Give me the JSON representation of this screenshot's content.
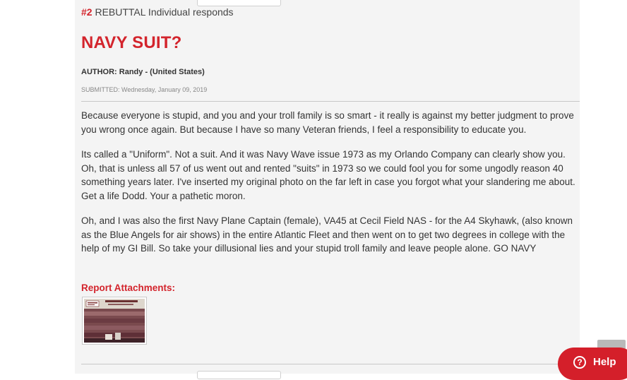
{
  "rebuttal": {
    "number": "#2",
    "text": "REBUTTAL Individual responds"
  },
  "post": {
    "title": "NAVY SUIT?",
    "author": "AUTHOR: Randy - (United States)",
    "submitted": "SUBMITTED: Wednesday, January 09, 2019",
    "paragraphs": [
      "Because everyone is stupid, and you and your troll family is so smart - it really is against my better judgment to prove you wrong once again.  But because I have so many Veteran friends, I feel a responsibility to educate you.",
      "Its called a \"Uniform\".  Not a suit.  And it was Navy Wave issue 1973 as my Orlando Company can clearly show you.  Oh, that is unless all 57 of us went out and rented \"suits\" in 1973 so we could fool you for some ungodly reason 40 something years later.  I've inserted my original photo on the far left in case you forgot what your slandering me about.  Get a life Dodd.  Your a pathetic moron.",
      "Oh, and I was also the first Navy Plane Captain (female), VA45 at Cecil Field NAS - for the A4 Skyhawk,  (also known as the Blue Angels for air shows) in the entire Atlantic Fleet and then went on to get two degrees in college with the help of my GI Bill.   So take your dillusional lies and your stupid troll family and leave people alone.  GO NAVY"
    ],
    "attachments_label": "Report Attachments:"
  },
  "widgets": {
    "help_label": "Help",
    "help_icon": "question-circle-icon",
    "scroll_top_icon": "scroll-to-top-icon"
  },
  "colors": {
    "accent": "#d3242c",
    "help_button": "#d41f2a",
    "panel": "#f4f4f4"
  }
}
